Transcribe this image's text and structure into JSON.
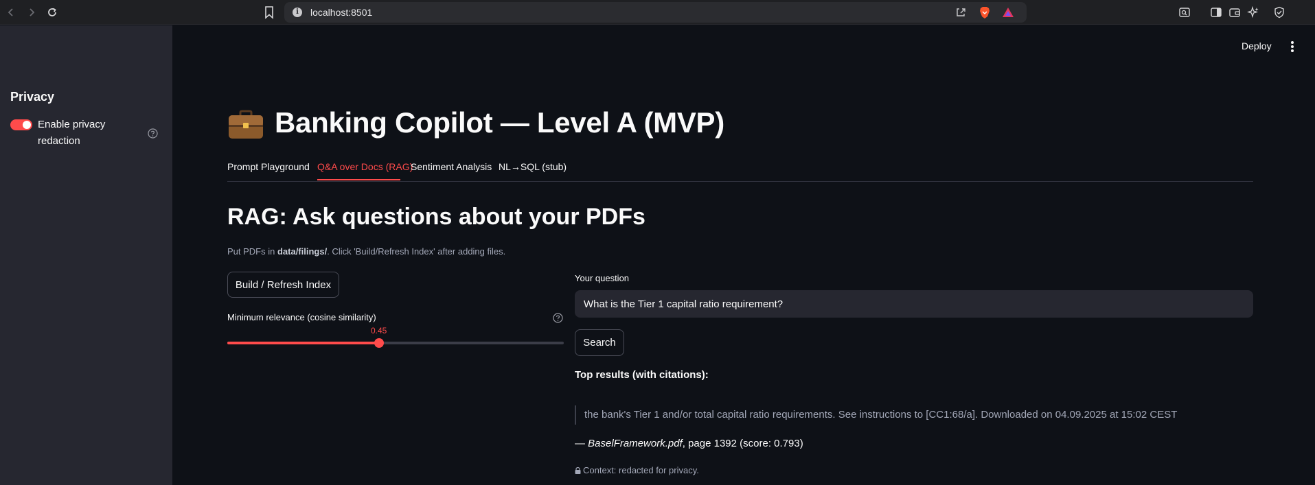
{
  "browser": {
    "url": "localhost:8501",
    "icons": [
      "back-icon",
      "forward-icon",
      "reload-icon",
      "bookmark-icon",
      "site-info-icon",
      "share-icon",
      "brave-shields-icon",
      "brave-rewards-icon",
      "reader-mode-icon",
      "sidebar-icon",
      "wallet-icon",
      "leo-ai-icon",
      "vpn-icon"
    ]
  },
  "sidebar": {
    "title": "Privacy",
    "toggle_label": "Enable privacy redaction",
    "toggle_on": true
  },
  "header": {
    "deploy_label": "Deploy"
  },
  "main": {
    "title_icon": "briefcase-emoji",
    "title": "Banking Copilot — Level A (MVP)",
    "tabs": [
      {
        "label": "Prompt Playground",
        "active": false
      },
      {
        "label": "Q&A over Docs (RAG)",
        "active": true
      },
      {
        "label": "Sentiment Analysis",
        "active": false
      },
      {
        "label": "NL→SQL (stub)",
        "active": false
      }
    ],
    "section_title": "RAG: Ask questions about your PDFs",
    "caption_prefix": "Put PDFs in ",
    "caption_path": "data/filings/",
    "caption_suffix": ". Click 'Build/Refresh Index' after adding files.",
    "build_button": "Build / Refresh Index",
    "slider": {
      "label": "Minimum relevance (cosine similarity)",
      "value": 0.45,
      "value_label": "0.45",
      "min": 0.0,
      "max": 1.0
    },
    "question": {
      "label": "Your question",
      "value": "What is the Tier 1 capital ratio requirement?"
    },
    "search_button": "Search",
    "results_heading": "Top results (with citations):",
    "result": {
      "quote": "the bank's Tier 1 and/or total capital ratio requirements. See instructions to [CC1:68/a]. Downloaded on 04.09.2025 at 15:02 CEST",
      "dash": "— ",
      "source": "BaselFramework.pdf",
      "details": ", page 1392 (score: 0.793)"
    },
    "context_note": "Context: redacted for privacy."
  },
  "colors": {
    "accent": "#ff4b4b",
    "background": "#0e1117",
    "sidebar": "#262730"
  }
}
